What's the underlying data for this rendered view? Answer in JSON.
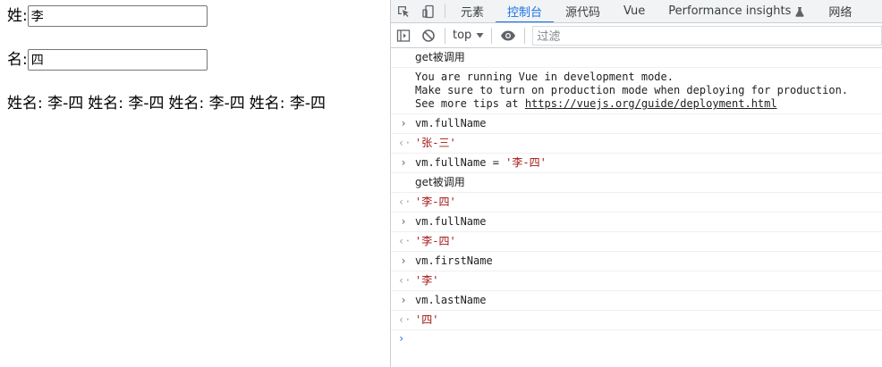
{
  "page": {
    "surname_label": "姓:",
    "surname_value": "李",
    "given_label": "名:",
    "given_value": "四",
    "fullname_outputs": [
      "姓名: 李-四",
      "姓名: 李-四",
      "姓名: 李-四",
      "姓名: 李-四"
    ]
  },
  "devtools": {
    "tabs": [
      "元素",
      "控制台",
      "源代码",
      "Vue",
      "Performance insights",
      "网络"
    ],
    "active_tab": "控制台",
    "context": "top",
    "filter_placeholder": "过滤",
    "messages": [
      {
        "kind": "log",
        "text": "get被调用"
      },
      {
        "kind": "log",
        "text": "You are running Vue in development mode.\nMake sure to turn on production mode when deploying for production.\nSee more tips at ",
        "link": "https://vuejs.org/guide/deployment.html"
      },
      {
        "kind": "input",
        "text": "vm.fullName"
      },
      {
        "kind": "result",
        "text": "'张-三'"
      },
      {
        "kind": "input",
        "text": "vm.fullName = ",
        "string": "'李-四'"
      },
      {
        "kind": "log",
        "text": "get被调用"
      },
      {
        "kind": "result",
        "text": "'李-四'"
      },
      {
        "kind": "input",
        "text": "vm.fullName"
      },
      {
        "kind": "result",
        "text": "'李-四'"
      },
      {
        "kind": "input",
        "text": "vm.firstName"
      },
      {
        "kind": "result",
        "text": "'李'"
      },
      {
        "kind": "input",
        "text": "vm.lastName"
      },
      {
        "kind": "result",
        "text": "'四'"
      }
    ],
    "icons": [
      "inspect-icon",
      "device-toggle-icon",
      "flask-icon",
      "sidebar-icon",
      "clear-console-icon",
      "dropdown-icon",
      "eye-icon"
    ],
    "colors": {
      "accent": "#1a73e8",
      "string": "#a31515"
    }
  }
}
